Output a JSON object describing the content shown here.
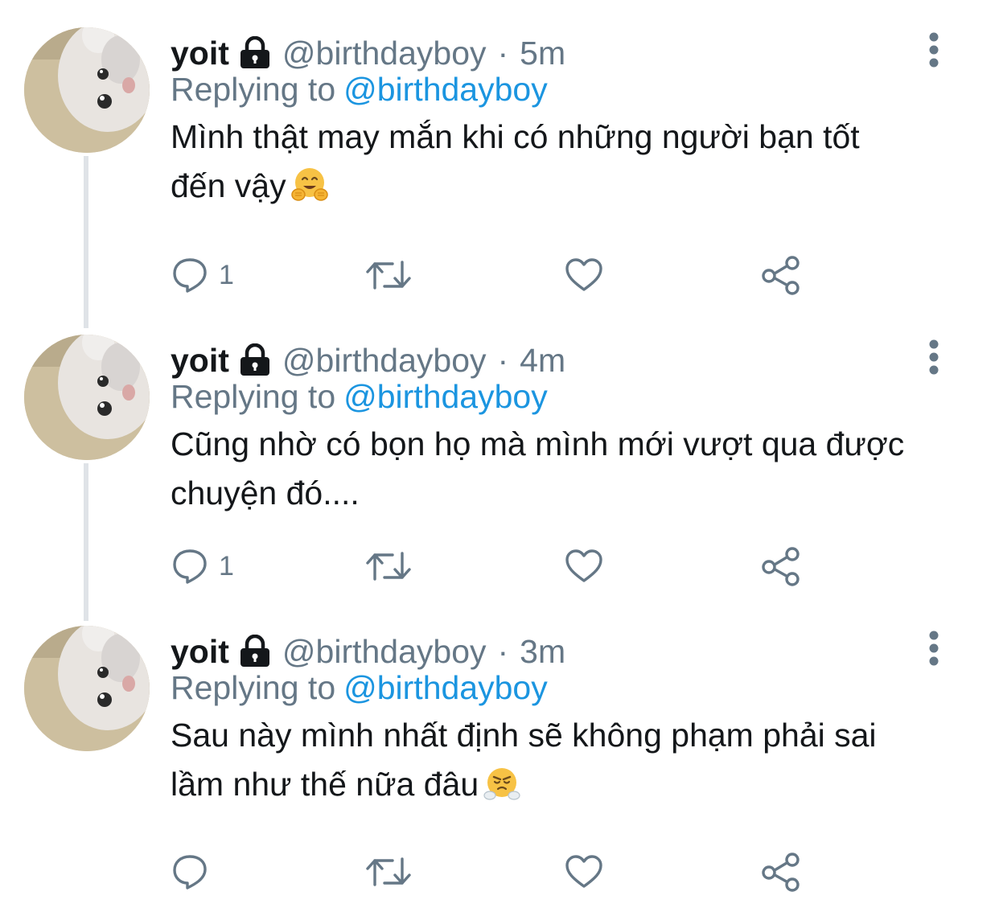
{
  "tweets": [
    {
      "name": "yoit",
      "handle": "@birthdayboy",
      "separator": "·",
      "time": "5m",
      "replying_prefix": "Replying to",
      "replying_to": "@birthdayboy",
      "line1": "Mình thật may mắn khi có những người bạn tốt",
      "line2": "đến vậy",
      "emoji": "hugging-face-emoji",
      "reply_count": "1"
    },
    {
      "name": "yoit",
      "handle": "@birthdayboy",
      "separator": "·",
      "time": "4m",
      "replying_prefix": "Replying to",
      "replying_to": "@birthdayboy",
      "line1": "Cũng nhờ có bọn họ mà mình mới vượt qua được",
      "line2": "chuyện đó....",
      "emoji": "",
      "reply_count": "1"
    },
    {
      "name": "yoit",
      "handle": "@birthdayboy",
      "separator": "·",
      "time": "3m",
      "replying_prefix": "Replying to",
      "replying_to": "@birthdayboy",
      "line1": "Sau này mình nhất định sẽ không phạm phải sai",
      "line2": "lầm như thế nữa đâu",
      "emoji": "face-with-steam-emoji",
      "reply_count": ""
    }
  ],
  "icons": {
    "protected": "lock-icon",
    "more": "more-vertical-icon",
    "reply": "reply-icon",
    "retweet": "retweet-icon",
    "like": "heart-icon",
    "share": "share-icon"
  },
  "colors": {
    "text": "#14171a",
    "secondary": "#657786",
    "link": "#1b95e0",
    "thread_line": "#dfe3e7"
  }
}
